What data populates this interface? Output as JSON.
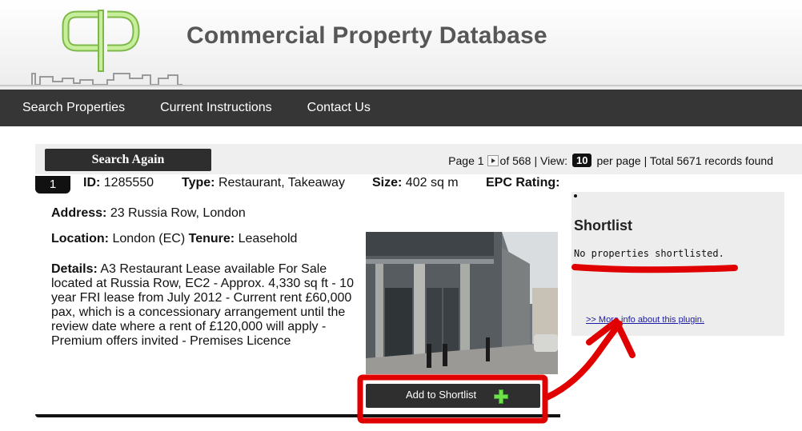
{
  "header": {
    "logo_alt": "CPD",
    "title": "Commercial Property Database"
  },
  "nav": {
    "items": [
      "Search Properties",
      "Current Instructions",
      "Contact Us"
    ]
  },
  "results": {
    "search_again_label": "Search Again",
    "page_label": "Page 1",
    "of_label": "of 568",
    "view_label": "| View:",
    "view_count": "10",
    "per_page_label": "per page | Total 5671 records found"
  },
  "listing": {
    "number": "1",
    "id_label": "ID:",
    "id_value": "1285550",
    "type_label": "Type:",
    "type_value": "Restaurant, Takeaway",
    "size_label": "Size:",
    "size_value": "402 sq m",
    "epc_label": "EPC Rating:",
    "address_label": "Address:",
    "address_value": "23 Russia Row, London",
    "location_label": "Location:",
    "location_value": "London (EC)",
    "tenure_label": "Tenure:",
    "tenure_value": "Leasehold",
    "details_label": "Details:",
    "details_value": "A3 Restaurant Lease available For Sale located at Russia Row, EC2 - Approx. 4,330 sq ft - 10 year FRI lease from July 2012 - Current rent £60,000 pax, which is a concessionary arrangement until the review date where a rent of £120,000 will apply - Premium offers invited - Premises Licence",
    "add_shortlist_label": "Add to Shortlist"
  },
  "sidebar": {
    "title": "Shortlist",
    "empty_message": "No properties shortlisted.",
    "plugin_link": ">> More info about this plugin."
  },
  "colors": {
    "nav_bg": "#363636",
    "logo_green": "#a6dc6a",
    "annotation_red": "#e00000",
    "plus_green": "#5bd13a"
  }
}
